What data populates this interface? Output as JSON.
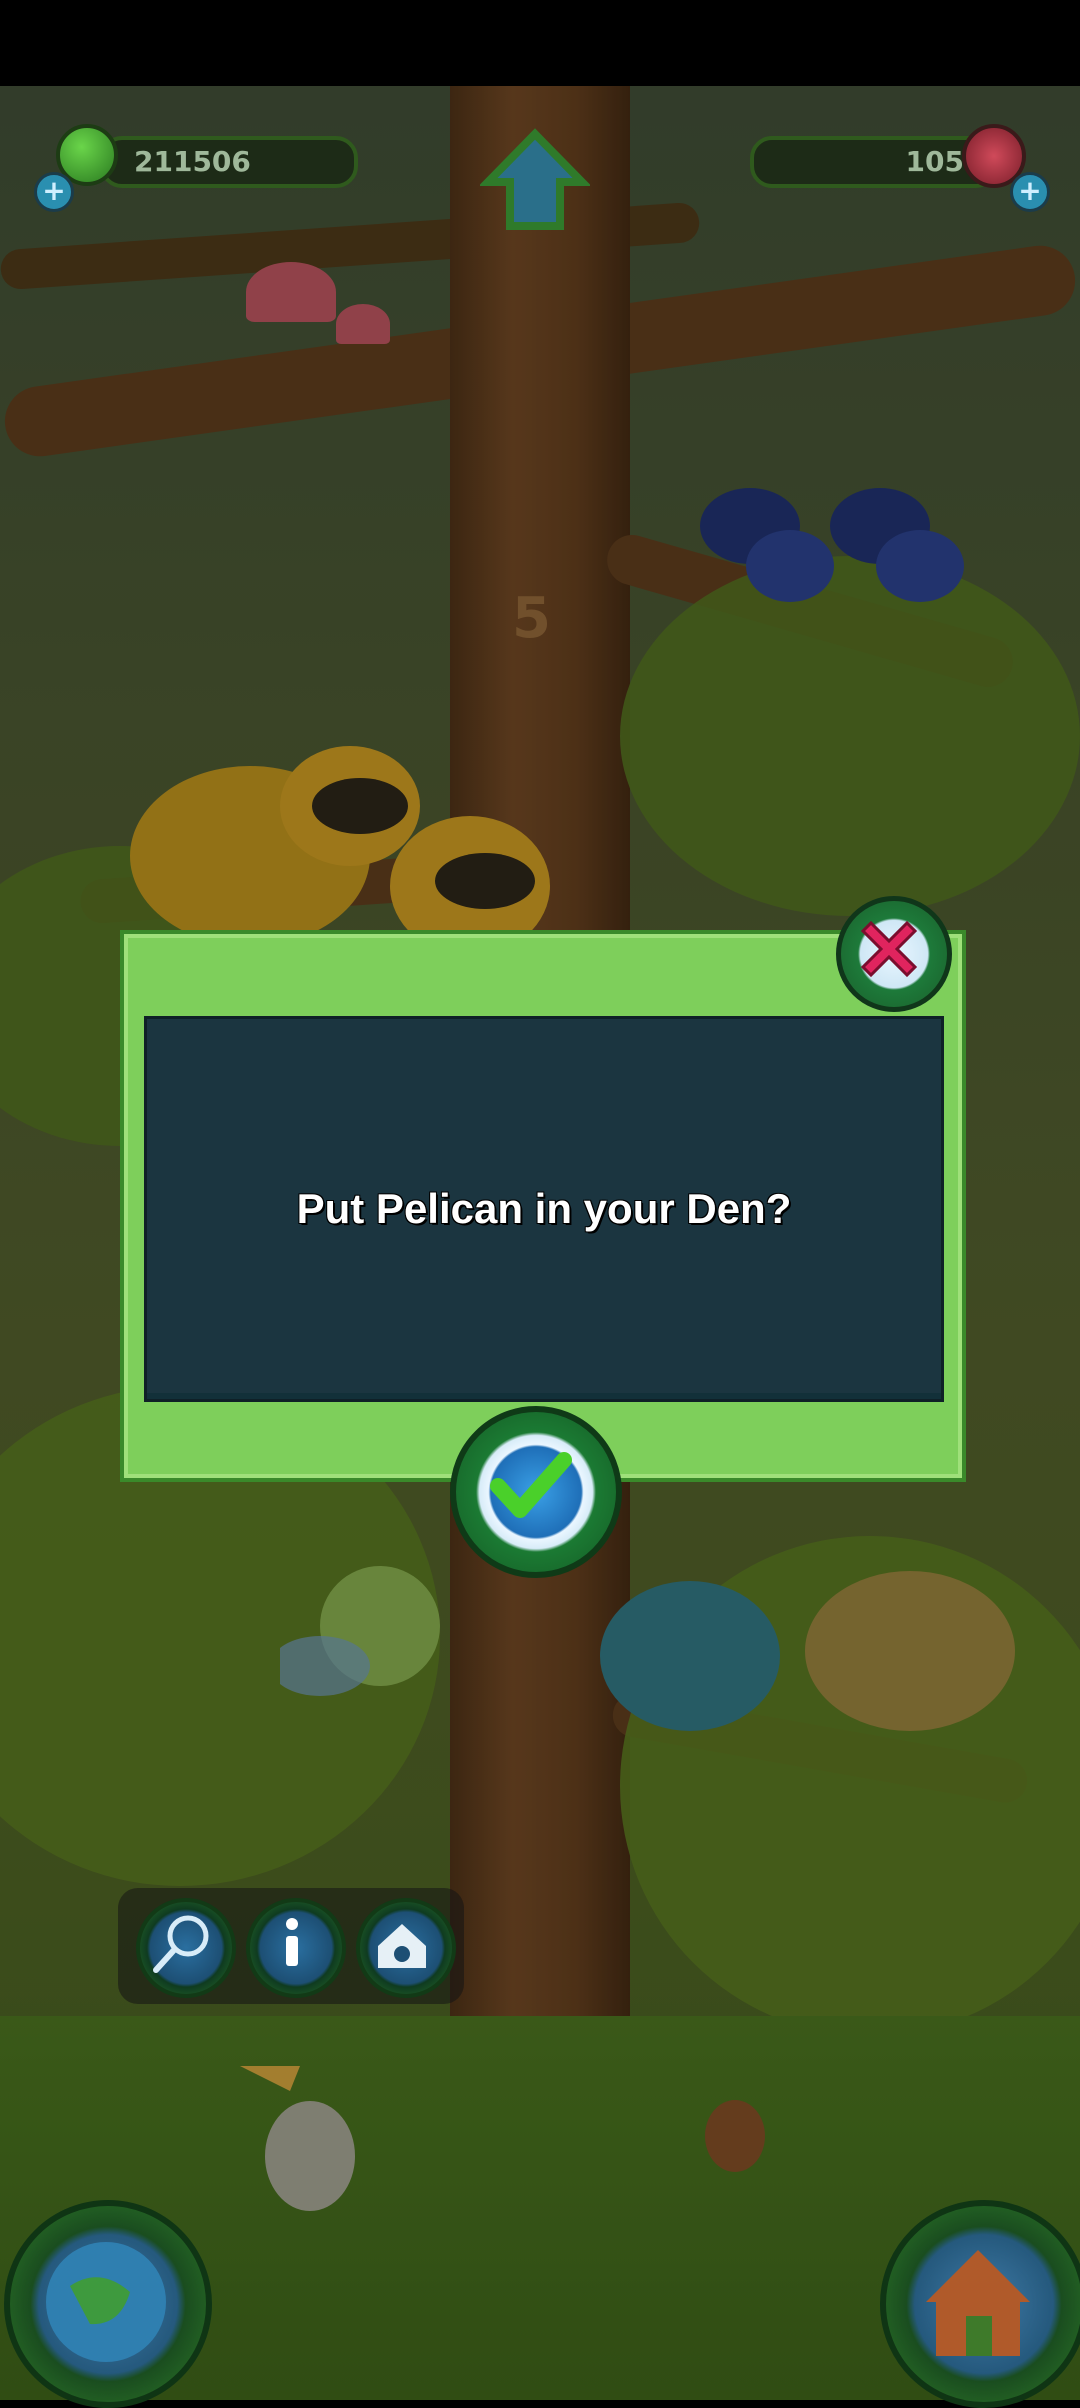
{
  "hud": {
    "leaf_count": "211506",
    "gem_count": "105"
  },
  "tree_level_marker": "5",
  "dialog": {
    "message": "Put Pelican in your Den?"
  },
  "colors": {
    "dialog_frame": "#7ecf5b",
    "dialog_panel": "#1b3540",
    "close_x": "#e0245e",
    "confirm_check": "#4ad02a"
  },
  "icons": {
    "left_tray": [
      "net-icon",
      "info-icon",
      "den-icon"
    ],
    "bottom_left": "globe-icon",
    "bottom_right": "house-icon",
    "top_center": "home-arrow-icon"
  }
}
